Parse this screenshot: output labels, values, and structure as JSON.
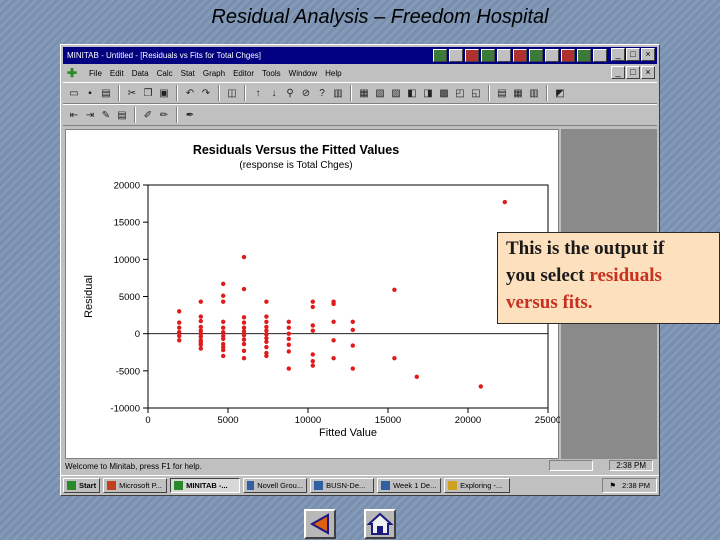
{
  "slide": {
    "title": "Residual Analysis – Freedom Hospital",
    "callout": {
      "line1": "This is the output if",
      "line2_pre": "you select ",
      "line2_highlight": "residuals",
      "line3": "versus fits."
    },
    "nav": [
      "back-arrow-icon",
      "home-icon"
    ]
  },
  "window": {
    "title": "MINITAB - Untitled - [Residuals vs Fits for Total Chges]",
    "controls": [
      "_",
      "□",
      "×"
    ],
    "menu": [
      "File",
      "Edit",
      "Data",
      "Calc",
      "Stat",
      "Graph",
      "Editor",
      "Tools",
      "Window",
      "Help"
    ],
    "menu_controls": [
      "_",
      "□",
      "×"
    ],
    "status_text": "Welcome to Minitab, press F1 for help.",
    "status_time": "2:38 PM"
  },
  "taskbar": {
    "start_label": "Start",
    "tasks": [
      "Microsoft P...",
      "MINITAB -...",
      "Novell Grou...",
      "BUSN-De...",
      "Week 1 De...",
      "Exploring -..."
    ],
    "active_task_index": 1,
    "time": "2:38 PM"
  },
  "colors": {
    "titlebar": "#000080",
    "points": "#e01b1b",
    "callout_bg": "#fde0bd",
    "highlight": "#c83020"
  },
  "chart_data": {
    "type": "scatter",
    "title": "Residuals Versus the Fitted Values",
    "subtitle": "(response is Total Chges)",
    "xlabel": "Fitted Value",
    "ylabel": "Residual",
    "xlim": [
      0,
      25000
    ],
    "ylim": [
      -10000,
      20000
    ],
    "xticks": [
      0,
      5000,
      10000,
      15000,
      20000,
      25000
    ],
    "yticks": [
      -10000,
      -5000,
      0,
      5000,
      10000,
      15000,
      20000
    ],
    "xtick_labels": [
      "0",
      "5000",
      "10000",
      "15000",
      "20000",
      "25000"
    ],
    "ytick_labels": [
      "-10000",
      "-5000",
      "0",
      "5000",
      "10000",
      "15000",
      "20000"
    ],
    "reference_line": 0,
    "points": [
      [
        1950,
        3000
      ],
      [
        1950,
        1500
      ],
      [
        1950,
        800
      ],
      [
        1950,
        200
      ],
      [
        1950,
        -300
      ],
      [
        1950,
        -900
      ],
      [
        3300,
        4300
      ],
      [
        3300,
        2300
      ],
      [
        3300,
        1700
      ],
      [
        3300,
        900
      ],
      [
        3300,
        400
      ],
      [
        3300,
        0
      ],
      [
        3300,
        -400
      ],
      [
        3300,
        -900
      ],
      [
        3300,
        -1500
      ],
      [
        3300,
        -2000
      ],
      [
        3300,
        -1200
      ],
      [
        4700,
        6700
      ],
      [
        4700,
        5100
      ],
      [
        4700,
        4300
      ],
      [
        4700,
        1600
      ],
      [
        4700,
        800
      ],
      [
        4700,
        200
      ],
      [
        4700,
        -300
      ],
      [
        4700,
        -700
      ],
      [
        4700,
        -1400
      ],
      [
        4700,
        -2200
      ],
      [
        4700,
        -3000
      ],
      [
        4700,
        -1800
      ],
      [
        6000,
        10300
      ],
      [
        6000,
        6000
      ],
      [
        6000,
        2200
      ],
      [
        6000,
        1500
      ],
      [
        6000,
        800
      ],
      [
        6000,
        300
      ],
      [
        6000,
        -200
      ],
      [
        6000,
        -800
      ],
      [
        6000,
        -1400
      ],
      [
        6000,
        -2300
      ],
      [
        6000,
        -3300
      ],
      [
        7400,
        4300
      ],
      [
        7400,
        2300
      ],
      [
        7400,
        1600
      ],
      [
        7400,
        900
      ],
      [
        7400,
        400
      ],
      [
        7400,
        -100
      ],
      [
        7400,
        -600
      ],
      [
        7400,
        -1100
      ],
      [
        7400,
        -1800
      ],
      [
        7400,
        -2600
      ],
      [
        7400,
        -3000
      ],
      [
        8800,
        1600
      ],
      [
        8800,
        800
      ],
      [
        8800,
        0
      ],
      [
        8800,
        -700
      ],
      [
        8800,
        -1500
      ],
      [
        8800,
        -2400
      ],
      [
        8800,
        -4700
      ],
      [
        10300,
        4300
      ],
      [
        10300,
        3600
      ],
      [
        10300,
        1100
      ],
      [
        10300,
        400
      ],
      [
        10300,
        -2800
      ],
      [
        10300,
        -4300
      ],
      [
        10300,
        -3700
      ],
      [
        11600,
        4300
      ],
      [
        11600,
        4000
      ],
      [
        11600,
        1600
      ],
      [
        11600,
        -900
      ],
      [
        11600,
        -3300
      ],
      [
        12800,
        1600
      ],
      [
        12800,
        500
      ],
      [
        12800,
        -1600
      ],
      [
        12800,
        -4700
      ],
      [
        15400,
        5900
      ],
      [
        15400,
        -3300
      ],
      [
        16800,
        -5800
      ],
      [
        20800,
        -7100
      ],
      [
        22300,
        17700
      ]
    ]
  }
}
